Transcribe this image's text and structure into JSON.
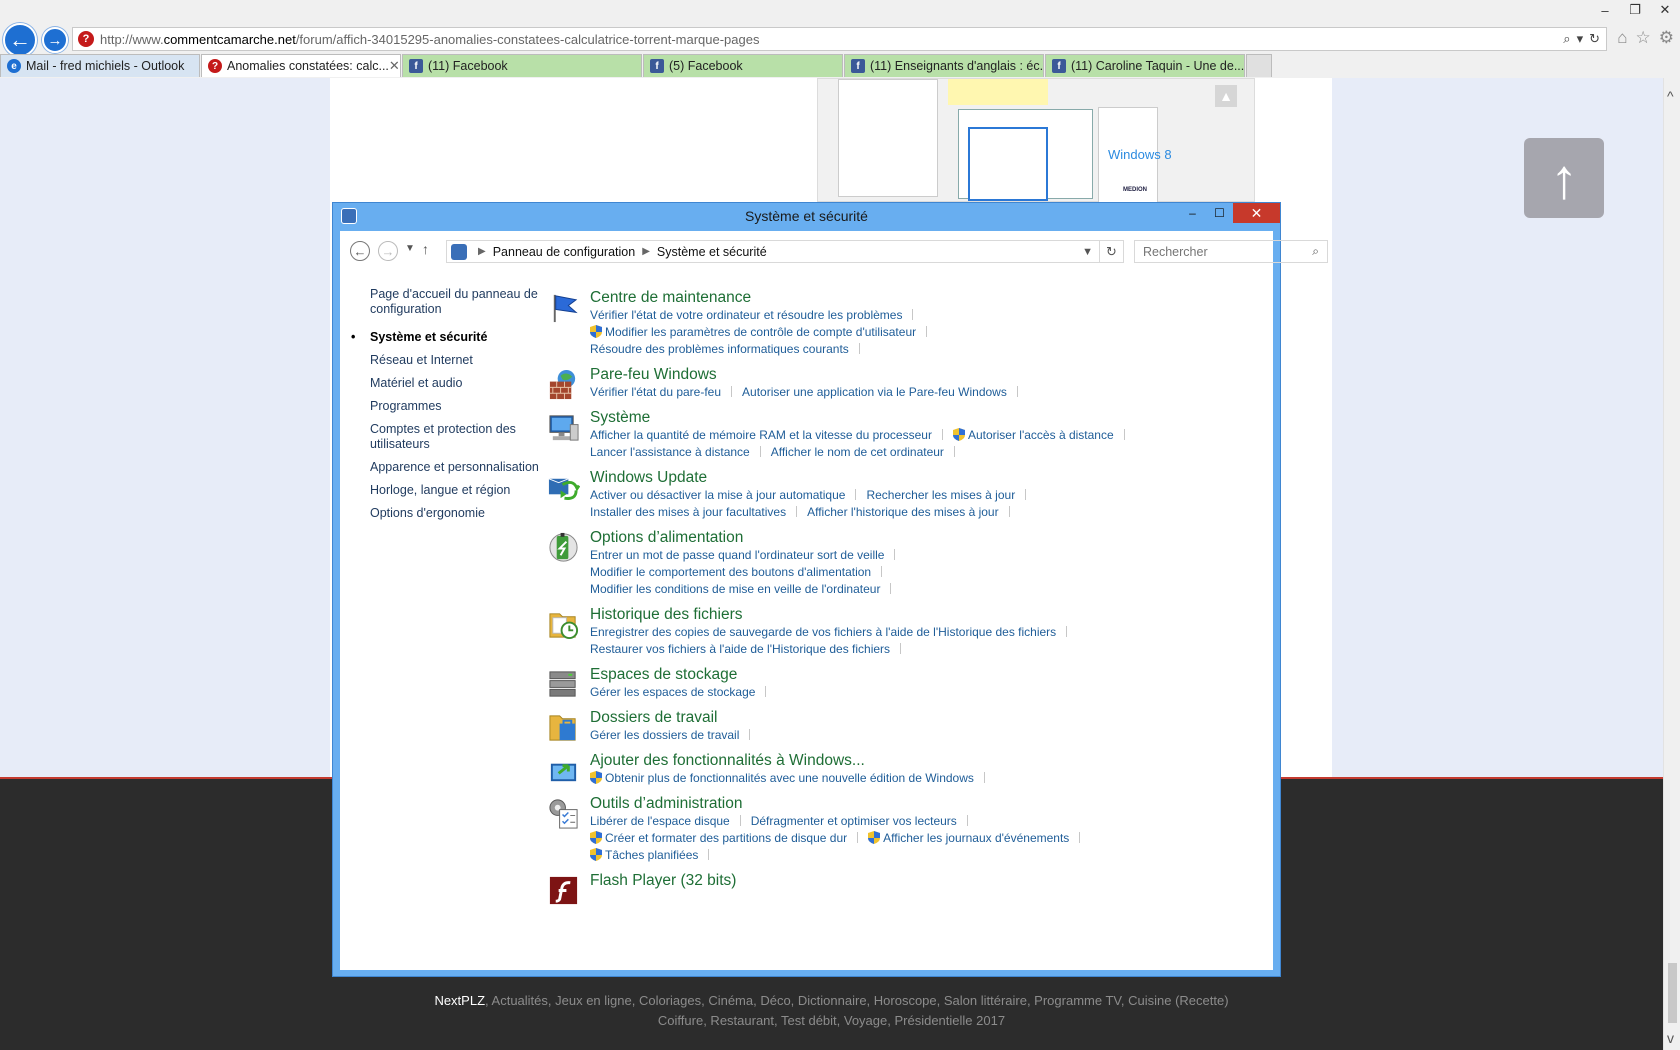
{
  "browser": {
    "url_prefix": "http://www.",
    "url_domain": "commentcamarche.net",
    "url_path": "/forum/affich-34015295-anomalies-constatees-calculatrice-torrent-marque-pages",
    "tabs": [
      {
        "label": "Mail - fred michiels - Outlook",
        "icon": "ie-icon"
      },
      {
        "label": "Anomalies constatées: calc...",
        "icon": "ccm-icon",
        "active": true
      },
      {
        "label": "(11) Facebook",
        "icon": "facebook-icon"
      },
      {
        "label": "(5) Facebook",
        "icon": "facebook-icon"
      },
      {
        "label": "(11) Enseignants d'anglais : éc...",
        "icon": "facebook-icon"
      },
      {
        "label": "(11) Caroline Taquin - Une de...",
        "icon": "facebook-icon"
      }
    ]
  },
  "thumb": {
    "windows8_text": "Windows 8",
    "medion_text": "MEDION"
  },
  "footer": {
    "brand": "NextPLZ",
    "line1_links": "Actualités, Jeux en ligne, Coloriages, Cinéma, Déco, Dictionnaire, Horoscope, Salon littéraire, Programme TV, Cuisine (Recette)",
    "line2_links": "Coiffure, Restaurant, Test débit, Voyage, Présidentielle 2017"
  },
  "control_panel": {
    "title": "Système et sécurité",
    "breadcrumb": [
      "Panneau de configuration",
      "Système et sécurité"
    ],
    "search_placeholder": "Rechercher",
    "left_nav": [
      "Page d'accueil du panneau de configuration",
      "Système et sécurité",
      "Réseau et Internet",
      "Matériel et audio",
      "Programmes",
      "Comptes et protection des utilisateurs",
      "Apparence et personnalisation",
      "Horloge, langue et région",
      "Options d'ergonomie"
    ],
    "categories": [
      {
        "title": "Centre de maintenance",
        "icon": "flag-icon",
        "lines": [
          [
            "Vérifier l'état de votre ordinateur et résoudre les problèmes"
          ],
          [
            "shield:Modifier les paramètres de contrôle de compte d'utilisateur"
          ],
          [
            "Résoudre des problèmes informatiques courants"
          ]
        ]
      },
      {
        "title": "Pare-feu Windows",
        "icon": "firewall-icon",
        "lines": [
          [
            "Vérifier l'état du pare-feu",
            "Autoriser une application via le Pare-feu Windows"
          ]
        ]
      },
      {
        "title": "Système",
        "icon": "computer-icon",
        "lines": [
          [
            "Afficher la quantité de mémoire RAM et la vitesse du processeur",
            "shield:Autoriser l'accès à distance"
          ],
          [
            "Lancer l'assistance à distance",
            "Afficher le nom de cet ordinateur"
          ]
        ]
      },
      {
        "title": "Windows Update",
        "icon": "update-icon",
        "lines": [
          [
            "Activer ou désactiver la mise à jour automatique",
            "Rechercher les mises à jour"
          ],
          [
            "Installer des mises à jour facultatives",
            "Afficher l'historique des mises à jour"
          ]
        ]
      },
      {
        "title": "Options d’alimentation",
        "icon": "battery-icon",
        "lines": [
          [
            "Entrer un mot de passe quand l'ordinateur sort de veille"
          ],
          [
            "Modifier le comportement des boutons d'alimentation"
          ],
          [
            "Modifier les conditions de mise en veille de l'ordinateur"
          ]
        ]
      },
      {
        "title": "Historique des fichiers",
        "icon": "file-history-icon",
        "lines": [
          [
            "Enregistrer des copies de sauvegarde de vos fichiers à l'aide de l'Historique des fichiers"
          ],
          [
            "Restaurer vos fichiers à l'aide de l'Historique des fichiers"
          ]
        ]
      },
      {
        "title": "Espaces de stockage",
        "icon": "storage-icon",
        "lines": [
          [
            "Gérer les espaces de stockage"
          ]
        ]
      },
      {
        "title": "Dossiers de travail",
        "icon": "work-folders-icon",
        "lines": [
          [
            "Gérer les dossiers de travail"
          ]
        ]
      },
      {
        "title": "Ajouter des fonctionnalités à Windows...",
        "icon": "add-features-icon",
        "lines": [
          [
            "shield:Obtenir plus de fonctionnalités avec une nouvelle édition de Windows"
          ]
        ]
      },
      {
        "title": "Outils d’administration",
        "icon": "admin-tools-icon",
        "lines": [
          [
            "Libérer de l'espace disque",
            "Défragmenter et optimiser vos lecteurs"
          ],
          [
            "shield:Créer et formater des partitions de disque dur",
            "shield:Afficher les journaux d'événements"
          ],
          [
            "shield:Tâches planifiées"
          ]
        ]
      },
      {
        "title": "Flash Player (32 bits)",
        "icon": "flash-icon",
        "lines": []
      }
    ]
  }
}
